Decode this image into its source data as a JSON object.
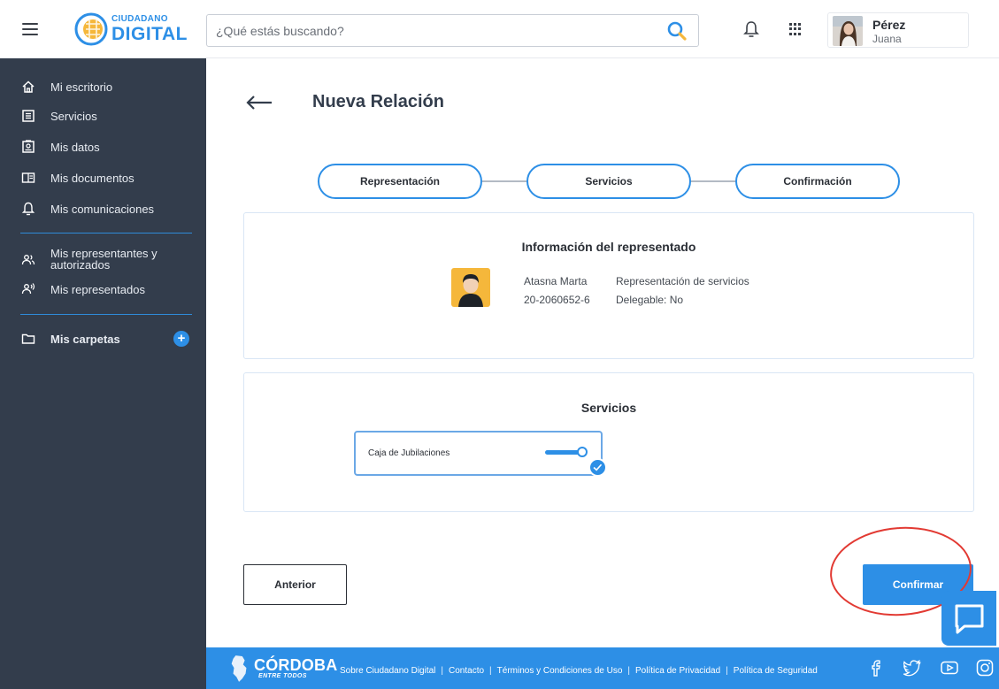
{
  "header": {
    "logo_small": "CIUDADANO",
    "logo_big": "DIGITAL",
    "search_placeholder": "¿Qué estás buscando?",
    "user": {
      "name": "Pérez",
      "sub": "Juana"
    }
  },
  "sidebar": {
    "items": [
      {
        "label": "Mi escritorio",
        "icon": "home-icon"
      },
      {
        "label": "Servicios",
        "icon": "services-icon"
      },
      {
        "label": "Mis datos",
        "icon": "id-card-icon"
      },
      {
        "label": "Mis documentos",
        "icon": "documents-icon"
      },
      {
        "label": "Mis comunicaciones",
        "icon": "bell-icon"
      }
    ],
    "items2": [
      {
        "label_line1": "Mis representantes y",
        "label_line2": "autorizados",
        "icon": "representatives-icon"
      },
      {
        "label": "Mis representados",
        "icon": "represented-icon"
      }
    ],
    "folders": {
      "label": "Mis carpetas",
      "icon": "folder-icon",
      "add_label": "+"
    }
  },
  "main": {
    "title": "Nueva Relación",
    "steps": [
      "Representación",
      "Servicios",
      "Confirmación"
    ],
    "info_card": {
      "title": "Información del representado",
      "name": "Atasna Marta",
      "id": "20-2060652-6",
      "type": "Representación de servicios",
      "delegable": "Delegable: No"
    },
    "services_card": {
      "title": "Servicios",
      "service": "Caja de Jubilaciones",
      "toggle_on": true
    },
    "buttons": {
      "previous": "Anterior",
      "confirm": "Confirmar"
    }
  },
  "footer": {
    "brand": "CÓRDOBA",
    "brand_sub": "ENTRE TODOS",
    "links": [
      "Sobre Ciudadano Digital",
      "Contacto",
      "Términos y Condiciones de Uso",
      "Política de Privacidad",
      "Política de Seguridad"
    ],
    "social": [
      "facebook-icon",
      "twitter-icon",
      "youtube-icon",
      "instagram-icon"
    ]
  },
  "colors": {
    "accent": "#2d8fe6",
    "sidebar_bg": "#333d4c",
    "highlight": "#e23a33"
  }
}
